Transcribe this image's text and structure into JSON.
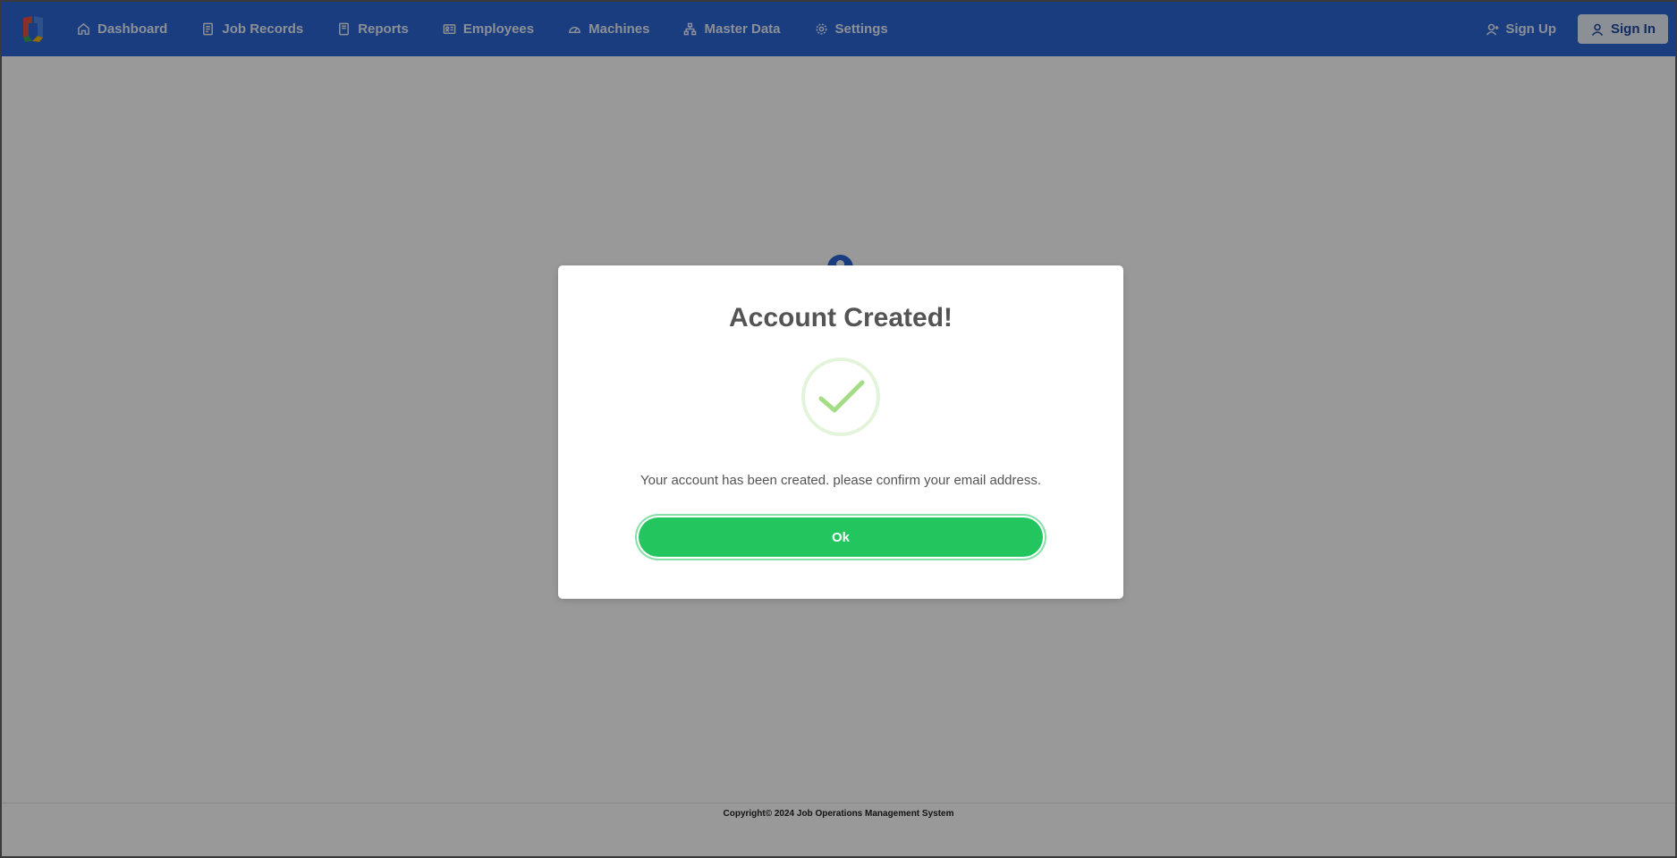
{
  "nav": {
    "items": [
      {
        "label": "Dashboard",
        "icon": "home-icon"
      },
      {
        "label": "Job Records",
        "icon": "document-icon"
      },
      {
        "label": "Reports",
        "icon": "report-icon"
      },
      {
        "label": "Employees",
        "icon": "id-card-icon"
      },
      {
        "label": "Machines",
        "icon": "gauge-icon"
      },
      {
        "label": "Master Data",
        "icon": "hierarchy-icon"
      },
      {
        "label": "Settings",
        "icon": "gear-icon"
      }
    ],
    "signup_label": "Sign Up",
    "signin_label": "Sign In"
  },
  "modal": {
    "title": "Account Created!",
    "message": "Your account has been created. please confirm your email address.",
    "ok_label": "Ok",
    "icon": "success-check-icon"
  },
  "footer": {
    "copyright": "Copyright© 2024 Job Operations Management System"
  },
  "colors": {
    "navbar": "#2c66d6",
    "ok_button": "#22c55e",
    "check": "#a5dc86",
    "overlay": "rgba(0,0,0,0.40)"
  }
}
